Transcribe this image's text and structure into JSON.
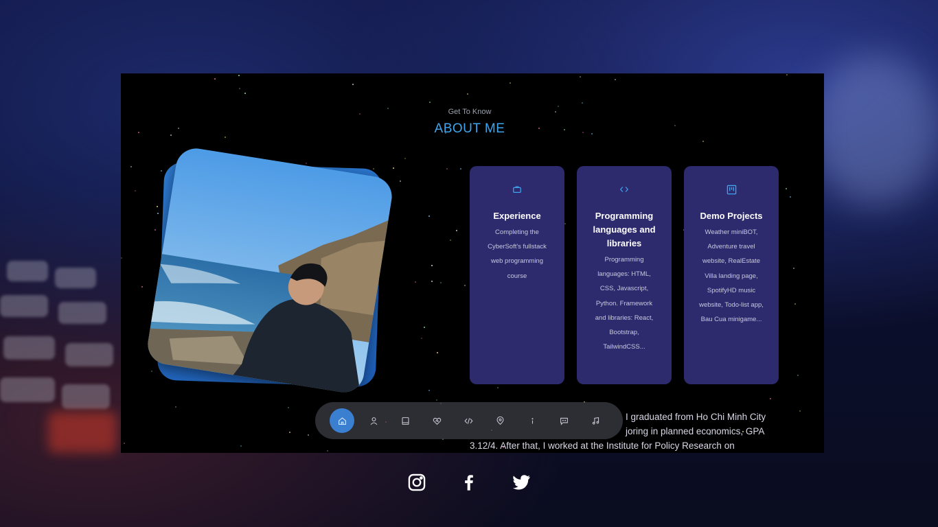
{
  "header": {
    "eyebrow": "Get To Know",
    "title": "ABOUT ME"
  },
  "photo": {
    "alt": "Portrait photo by the sea"
  },
  "cards": [
    {
      "icon": "briefcase-icon",
      "title": "Experience",
      "description": "Completing the CyberSoft's fullstack web programming course"
    },
    {
      "icon": "code-icon",
      "title": "Programming languages and libraries",
      "description": "Programming languages: HTML, CSS, Javascript, Python. Framework and libraries: React, Bootstrap, TailwindCSS..."
    },
    {
      "icon": "kanban-icon",
      "title": "Demo Projects",
      "description": "Weather miniBOT, Adventure travel website, RealEstate Villa landing page, SpotifyHD music website, Todo-list app, Bau Cua minigame..."
    }
  ],
  "about_text": {
    "line1": "I graduated from Ho Chi Minh City",
    "line2": "joring in planned economics, GPA",
    "line3": "3.12/4. After that, I worked at the Institute for Policy Research on"
  },
  "nav": {
    "items": [
      {
        "icon": "home-icon",
        "active": true
      },
      {
        "icon": "user-icon"
      },
      {
        "icon": "book-icon"
      },
      {
        "icon": "heart-icon"
      },
      {
        "icon": "code-icon"
      },
      {
        "icon": "location-icon"
      },
      {
        "icon": "info-icon"
      },
      {
        "icon": "chat-icon"
      },
      {
        "icon": "music-icon"
      }
    ],
    "accent": "#3a7fd0"
  },
  "socials": [
    {
      "icon": "instagram-icon"
    },
    {
      "icon": "facebook-icon"
    },
    {
      "icon": "twitter-icon"
    }
  ],
  "colors": {
    "accent": "#3ea6ee",
    "card_bg": "#2d2a6e",
    "frame_bg": "#000000"
  }
}
